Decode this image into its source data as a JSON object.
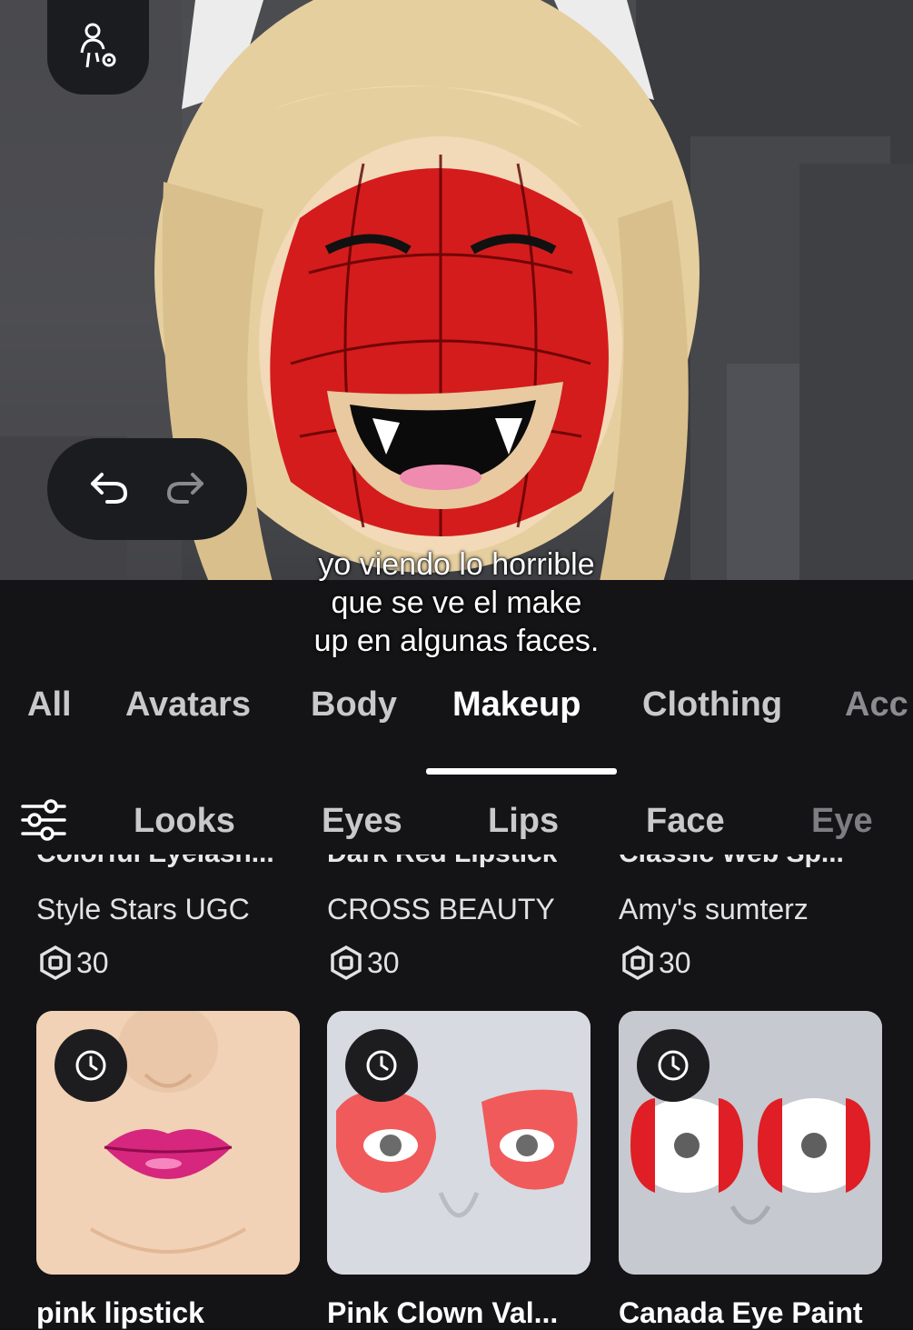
{
  "caption": {
    "line1": "yo viendo lo horrible",
    "line2": "que se ve el make",
    "line3": "up en algunas faces."
  },
  "toolbar": {
    "avatar_settings_icon": "person-gear-icon",
    "undo_icon": "undo-arrow-icon",
    "redo_icon": "redo-arrow-icon"
  },
  "tabs": [
    {
      "label": "All",
      "active": false
    },
    {
      "label": "Avatars",
      "active": false
    },
    {
      "label": "Body",
      "active": false
    },
    {
      "label": "Makeup",
      "active": true
    },
    {
      "label": "Clothing",
      "active": false
    },
    {
      "label": "Acc",
      "active": false
    }
  ],
  "subtabs": {
    "filter_icon": "sliders-icon",
    "items": [
      "Looks",
      "Eyes",
      "Lips",
      "Face",
      "Eye"
    ]
  },
  "top_row": [
    {
      "name_cutoff": "Colorful Eyelash...",
      "creator": "Style Stars UGC",
      "price": "30"
    },
    {
      "name_cutoff": "Dark Red Lipstick",
      "creator": "CROSS BEAUTY",
      "price": "30"
    },
    {
      "name_cutoff": "Classic Web Sp...",
      "creator": "Amy's sumterz",
      "price": "30"
    }
  ],
  "bottom_row": [
    {
      "name": "pink lipstick",
      "icon": "clock-icon"
    },
    {
      "name": "Pink Clown Val...",
      "icon": "clock-icon"
    },
    {
      "name": "Canada Eye Paint",
      "icon": "clock-icon"
    }
  ],
  "colors": {
    "panel_bg": "#141416",
    "accent_underline": "#ffffff",
    "tab_inactive": "#c9c9cc"
  }
}
